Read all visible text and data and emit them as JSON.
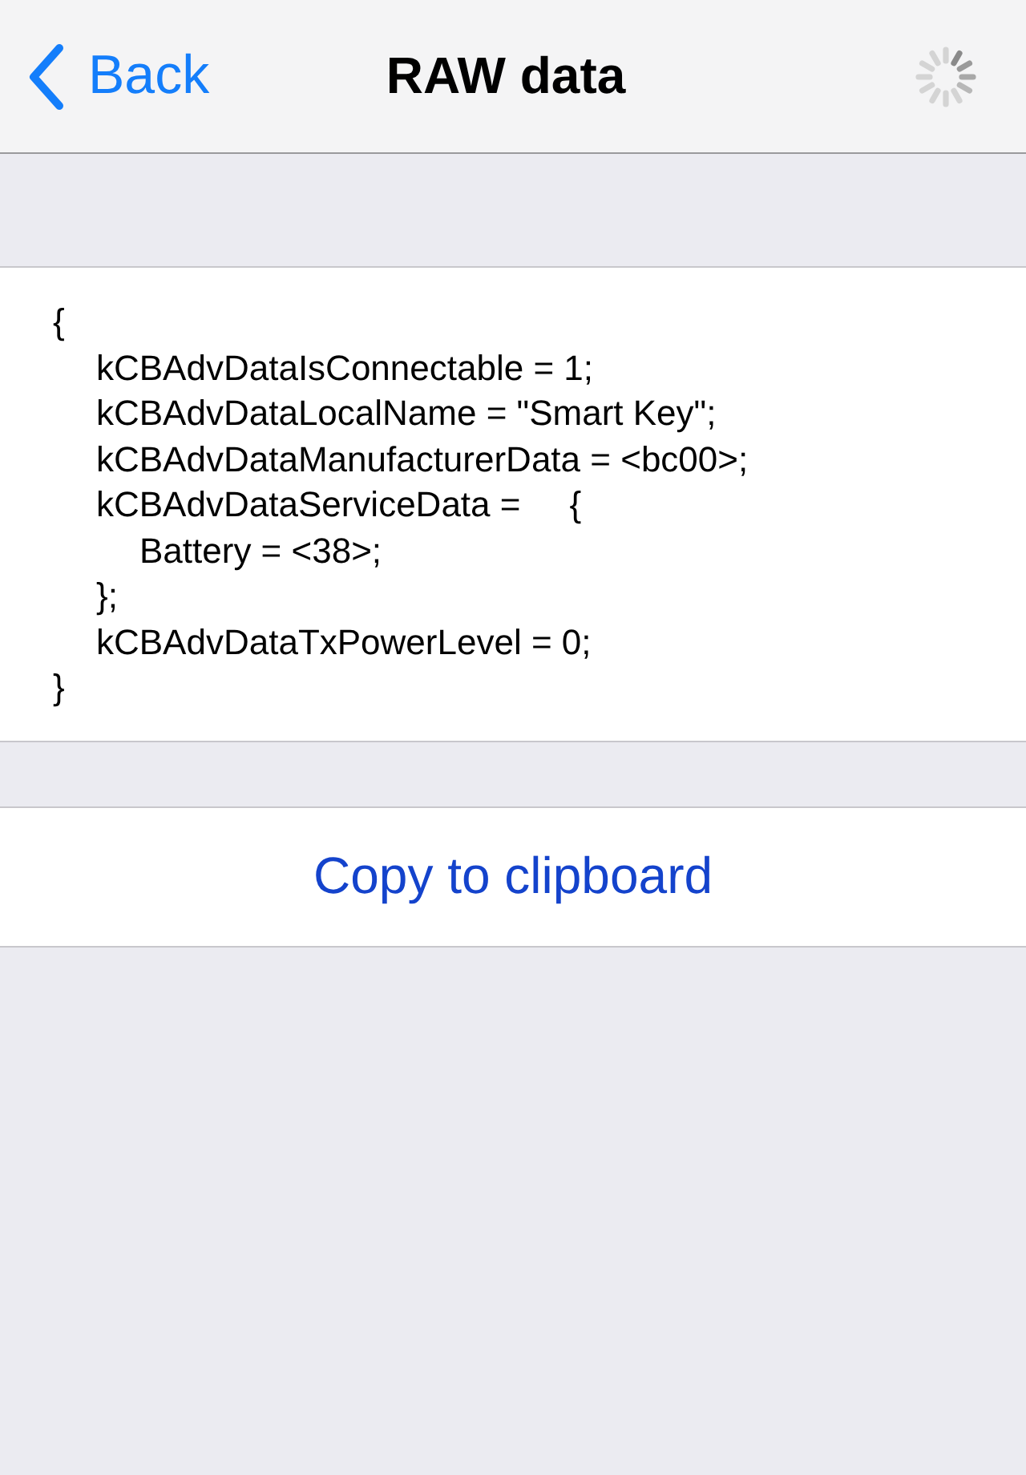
{
  "navigation_bar": {
    "back": "Back",
    "title": "RAW data"
  },
  "raw_data": {
    "lines": [
      {
        "text": "{",
        "children": [
          {
            "text": "kCBAdvDataIsConnectable = 1;"
          },
          {
            "text": "kCBAdvDataLocalName = \"Smart Key\";"
          },
          {
            "text": "kCBAdvDataManufacturerData = <bc00>;"
          },
          {
            "text": "kCBAdvDataServiceData =     {",
            "children": [
              {
                "text": "Battery = <38>;"
              }
            ]
          },
          {
            "text": "};"
          },
          {
            "text": "kCBAdvDataTxPowerLevel = 0;"
          }
        ]
      },
      {
        "text": "}"
      }
    ]
  },
  "actions": [
    {
      "label": "Copy to clipboard"
    }
  ]
}
